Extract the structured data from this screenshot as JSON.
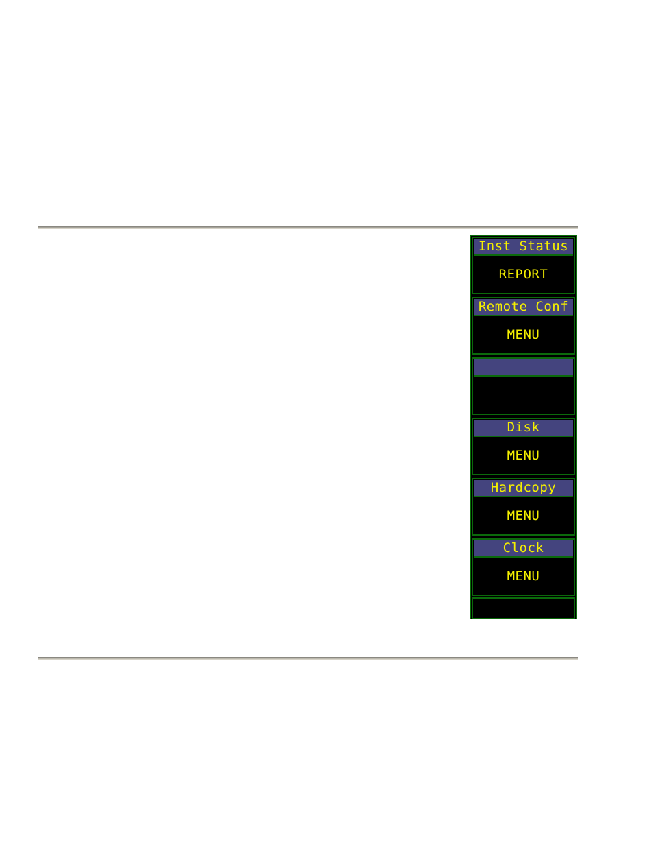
{
  "colors": {
    "panel_background": "#000000",
    "label_bar": "#44447e",
    "text": "#f5f000",
    "border": "#0b6a0b",
    "page_background": "#ffffff",
    "rule": "#9a9890"
  },
  "softkeys": [
    {
      "label": "Inst Status",
      "value": "REPORT"
    },
    {
      "label": "Remote Conf",
      "value": "MENU"
    },
    {
      "label": "",
      "value": ""
    },
    {
      "label": "Disk",
      "value": "MENU"
    },
    {
      "label": "Hardcopy",
      "value": "MENU"
    },
    {
      "label": "Clock",
      "value": "MENU"
    }
  ]
}
